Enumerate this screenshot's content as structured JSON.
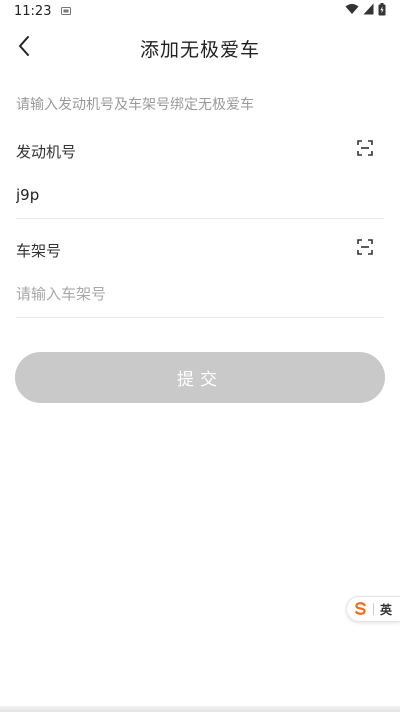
{
  "status_bar": {
    "time": "11:23",
    "notification_icon": "sim-card-icon",
    "wifi_icon": "wifi-icon",
    "signal_icon": "cell-signal-icon",
    "battery_icon": "battery-charging-icon"
  },
  "nav": {
    "back_icon": "chevron-left-icon",
    "title": "添加无极爱车"
  },
  "hint": "请输入发动机号及车架号绑定无极爱车",
  "form": {
    "engine": {
      "label": "发动机号",
      "value": "j9p",
      "placeholder": "",
      "scan_icon": "scan-icon"
    },
    "frame": {
      "label": "车架号",
      "value": "",
      "placeholder": "请输入车架号",
      "scan_icon": "scan-icon"
    }
  },
  "submit_label": "提交",
  "ime": {
    "logo_icon": "sogou-s-icon",
    "mode": "英"
  },
  "colors": {
    "submit_disabled": "#c9c9c9",
    "hint_text": "#9a9a9a",
    "divider": "#e8e8e8",
    "ime_logo": "#f26b1d"
  }
}
